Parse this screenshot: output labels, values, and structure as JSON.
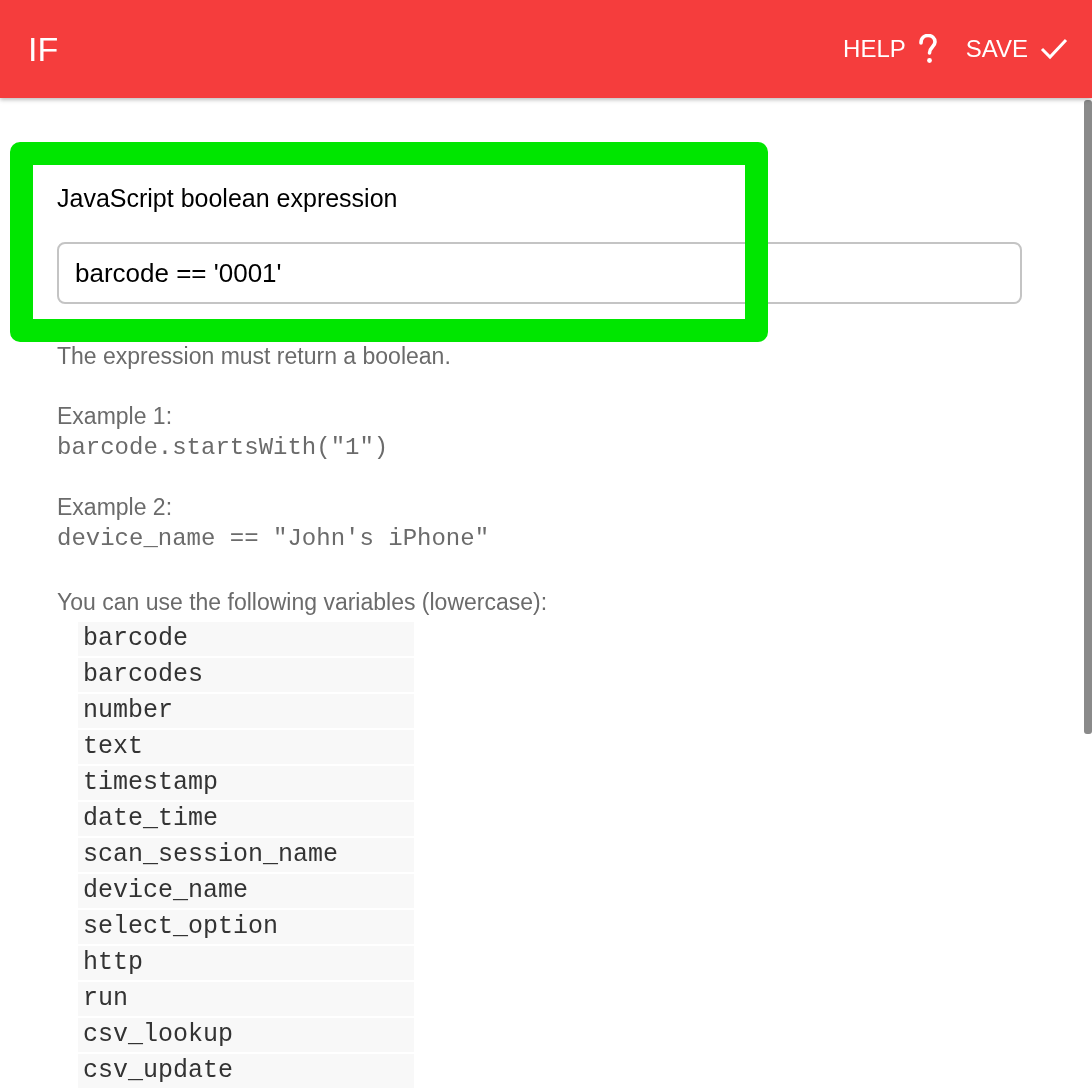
{
  "header": {
    "title": "IF",
    "actions": [
      {
        "label": "HELP",
        "kind": "help"
      },
      {
        "label": "SAVE",
        "kind": "save"
      }
    ]
  },
  "field": {
    "label": "JavaScript boolean expression",
    "value": "barcode == '0001'"
  },
  "help_text": "The expression must return a boolean.",
  "examples": [
    {
      "label": "Example 1:",
      "code": "barcode.startsWith(\"1\")"
    },
    {
      "label": "Example 2:",
      "code": "device_name == \"John's iPhone\""
    }
  ],
  "variables_intro": "You can use the following variables (lowercase):",
  "variables": [
    "barcode",
    "barcodes",
    "number",
    "text",
    "timestamp",
    "date_time",
    "scan_session_name",
    "device_name",
    "select_option",
    "http",
    "run",
    "csv_lookup",
    "csv_update"
  ]
}
